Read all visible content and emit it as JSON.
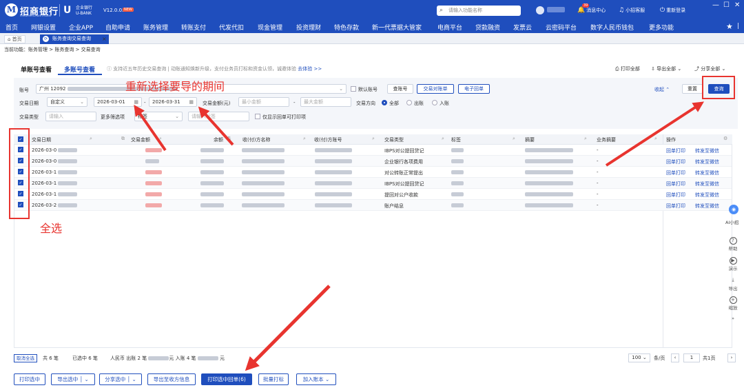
{
  "app": {
    "logo_text": "招商银行",
    "logo_sub": "CHINA MERCHANTS BANK",
    "product_line1": "企业银行",
    "product_line2": "U-BANK",
    "version": "V12.0.0.5",
    "version_badge": "NEW",
    "search_placeholder": "请输入功能名称",
    "message_count": "39",
    "message_center": "消息中心",
    "support": "小招客服",
    "relogin": "重新登录"
  },
  "nav": [
    "首页",
    "网银设置",
    "企业APP",
    "自助申请",
    "账务管理",
    "转账支付",
    "代发代扣",
    "现金管理",
    "投资理财",
    "特色存款",
    "新一代票据大管家",
    "电商平台",
    "贷款融资",
    "发票云",
    "云密码平台",
    "数字人民币钱包",
    "更多功能"
  ],
  "tabs": {
    "home": "首页",
    "active": "账务查询交易查询"
  },
  "breadcrumb": "当前功能：账务管理 > 账务查询 > 交易查询",
  "subtabs": {
    "single": "单账号查看",
    "multi": "多账号查看"
  },
  "tip": {
    "text": "支持近五年历史交易查询 | 动账通知焕新升级，支付业务员打标和资金认领，诚邀体验",
    "link": "去体验 >>"
  },
  "actions": {
    "print_all": "打印全部",
    "export_all": "导出全部",
    "share_all": "分享全部"
  },
  "filter": {
    "account_label": "账号",
    "account_value": "广州 12092",
    "default_account": "默认账号",
    "btn_check": "查账号",
    "btn_reconcile": "交易对账单",
    "btn_ereceipt": "电子回单",
    "collapse": "收起",
    "reset": "重置",
    "query": "查询",
    "date_label": "交易日期",
    "date_mode": "自定义",
    "date_start": "2026-03-01",
    "date_end": "2026-03-31",
    "amount_label": "交易金额(元)",
    "amount_min": "最小金额",
    "amount_max": "最大金额",
    "direction_label": "交易方向",
    "direction_options": [
      "全部",
      "出账",
      "入账"
    ],
    "type_label": "交易类型",
    "type_placeholder": "请输入",
    "more_label": "更多筛选项",
    "more_value": "标签",
    "more_placeholder": "请输入标签",
    "only_printable": "仅显示回单可打印项"
  },
  "table": {
    "headers": [
      "交易日期",
      "交易金额",
      "余额",
      "收(付)方名称",
      "收(付)方账号",
      "交易类型",
      "标签",
      "摘要",
      "业务摘要",
      "操作"
    ],
    "rows": [
      {
        "date": "2026-03-0",
        "type": "IBPS对公提回贷记",
        "biz": "-"
      },
      {
        "date": "2026-03-0",
        "type": "企业银行各项费用",
        "biz": "-"
      },
      {
        "date": "2026-03-1",
        "type": "对公转账正常提出",
        "biz": "-"
      },
      {
        "date": "2026-03-1",
        "type": "IBPS对公提回贷记",
        "biz": "-"
      },
      {
        "date": "2026-03-1",
        "type": "提回对公户收款",
        "biz": "-"
      },
      {
        "date": "2026-03-2",
        "type": "账户结息",
        "biz": "-"
      }
    ],
    "op_print": "回单打印",
    "op_forward": "转发至微信"
  },
  "footer": {
    "cancel_select": "取消全选",
    "total": "共 6 笔",
    "selected": "已选中 6 笔",
    "summary_a": "人民币 出账 2 笔",
    "summary_b": "元 入账 4 笔",
    "summary_c": "元",
    "page_size": "100",
    "page_unit": "条/页",
    "page_no": "1",
    "page_total": "共1页"
  },
  "bottom": {
    "print_selected": "打印选中",
    "export_selected": "导出选中",
    "share_selected": "分享选中",
    "export_payee": "导出至收方信息",
    "print_receipts": "打印选中回单(6)",
    "batch_tag": "批量打标",
    "add_ledger": "加入账本"
  },
  "side": {
    "ai": "AI小招",
    "help": "帮助",
    "demo": "演示",
    "export": "导出",
    "zoom": "缩放"
  },
  "annotations": {
    "reselect": "重新选择要导的期间",
    "select_all": "全选"
  }
}
